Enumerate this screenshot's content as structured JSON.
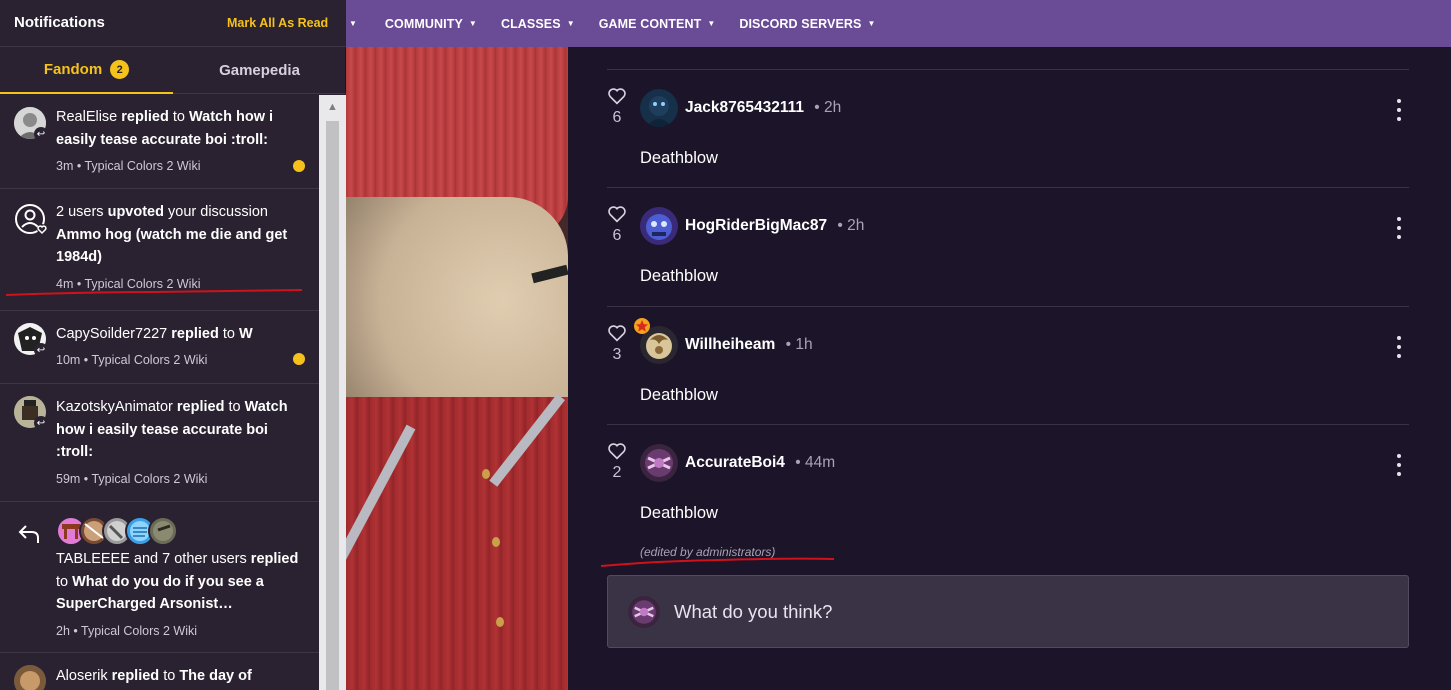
{
  "notifications_panel": {
    "title": "Notifications",
    "mark_all_read_label": "Mark All As Read",
    "tabs": [
      {
        "label": "Fandom",
        "badge": "2",
        "active": true
      },
      {
        "label": "Gamepedia",
        "active": false
      }
    ],
    "items": [
      {
        "actor": "RealElise",
        "action": "replied",
        "connector": "to",
        "target": "Watch how i easily tease accurate boi :troll:",
        "time": "3m",
        "wiki": "Typical Colors 2 Wiki",
        "unread": true,
        "avatar_icon": "user-avatar",
        "type_icon": "reply-icon"
      },
      {
        "prefix": "2 users",
        "action": "upvoted",
        "connector": "your discussion",
        "target": "Ammo hog (watch me die and get 1984d)",
        "time": "4m",
        "wiki": "Typical Colors 2 Wiki",
        "unread": false,
        "type_icon": "upvote-user-icon"
      },
      {
        "actor": "CapySoilder7227",
        "action": "replied",
        "connector": "to",
        "target": "W",
        "time": "10m",
        "wiki": "Typical Colors 2 Wiki",
        "unread": true,
        "type_icon": "reply-icon"
      },
      {
        "actor": "KazotskyAnimator",
        "action": "replied",
        "connector": "to",
        "target": "Watch how i easily tease accurate boi :troll:",
        "time": "59m",
        "wiki": "Typical Colors 2 Wiki",
        "unread": false,
        "type_icon": "reply-icon"
      },
      {
        "actor": "TABLEEEE",
        "others": "and 7 other users",
        "action": "replied",
        "connector": "to",
        "target": "What do you do if you see a SuperCharged Arsonist…",
        "time": "2h",
        "wiki": "Typical Colors 2 Wiki",
        "unread": false,
        "type_icon": "reply-arrow-icon"
      },
      {
        "actor": "Aloserik",
        "action": "replied",
        "connector": "to",
        "target": "The day of",
        "unread": false,
        "type_icon": "reply-icon"
      }
    ]
  },
  "topnav": {
    "items": [
      "COMMUNITY",
      "CLASSES",
      "GAME CONTENT",
      "DISCORD SERVERS"
    ],
    "caret_icon": "caret-down-icon"
  },
  "discussion": {
    "replies": [
      {
        "author": "Jack8765432111",
        "time": "2h",
        "likes": "6",
        "body": "Deathblow"
      },
      {
        "author": "HogRiderBigMac87",
        "time": "2h",
        "likes": "6",
        "body": "Deathblow"
      },
      {
        "author": "Willheiheam",
        "time": "1h",
        "likes": "3",
        "body": "Deathblow",
        "badge_icon": "star-badge-icon"
      },
      {
        "author": "AccurateBoi4",
        "time": "44m",
        "likes": "2",
        "body": "Deathblow",
        "edited_note": "(edited by administrators)"
      }
    ],
    "composer_placeholder": "What do you think?"
  },
  "colors": {
    "accent": "#f5c21c",
    "nav_bg": "#6a4b96",
    "panel_bg": "#2a2230",
    "main_bg": "#1c1428",
    "annotation_red": "#d0121b"
  }
}
